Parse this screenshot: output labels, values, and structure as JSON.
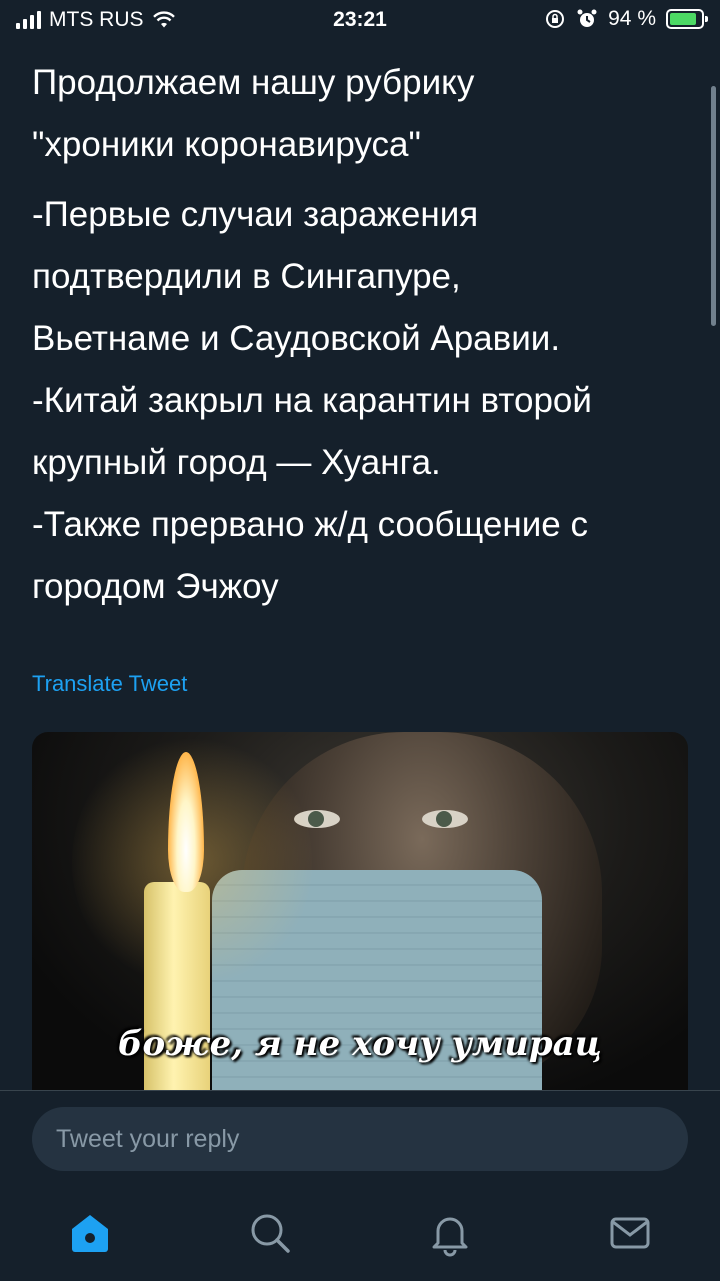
{
  "status_bar": {
    "carrier": "MTS RUS",
    "time": "23:21",
    "battery_percent": "94 %",
    "battery_level": 0.94,
    "icons": [
      "signal-icon",
      "wifi-icon",
      "orientation-lock-icon",
      "alarm-icon",
      "battery-charging-icon"
    ]
  },
  "tweet": {
    "heading_line1": "Продолжаем нашу рубрику",
    "heading_line2": "\"хроники коронавируса\"",
    "body_lines": [
      "-Первые случаи заражения",
      "подтвердили в Сингапуре,",
      "Вьетнаме и Саудовской Аравии.",
      "-Китай закрыл на карантин второй",
      "крупный город — Хуанга.",
      "-Также прервано ж/д сообщение с",
      "городом Эчжоу"
    ],
    "translate_label": "Translate Tweet",
    "media_caption": "боже, я не хочу умирац"
  },
  "reply": {
    "placeholder": "Tweet your reply"
  },
  "tab_bar": {
    "icons": [
      "home-icon",
      "search-icon",
      "notifications-icon",
      "messages-icon"
    ],
    "accent_color": "#1da1f2",
    "inactive_color": "#8899a6"
  },
  "colors": {
    "background": "#15202b",
    "link": "#1da1f2"
  }
}
